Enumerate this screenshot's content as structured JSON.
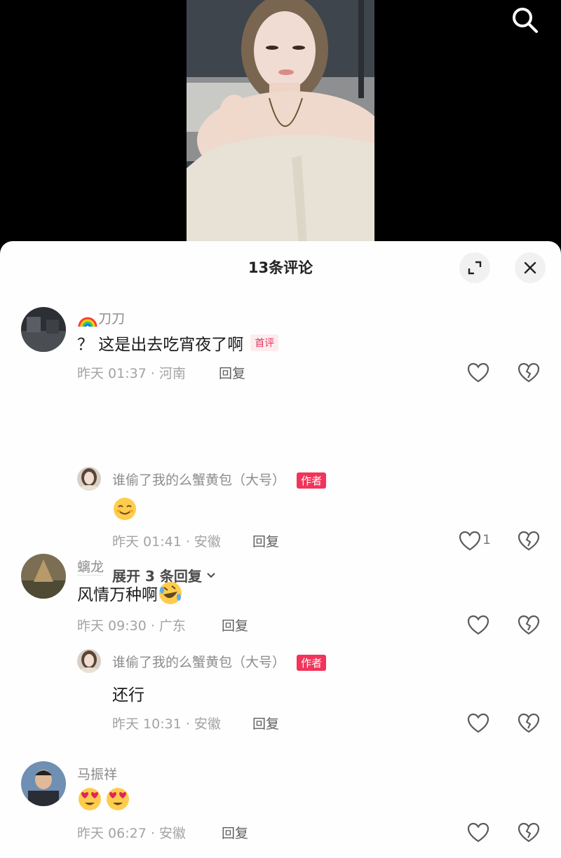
{
  "header": {
    "title": "13条评论"
  },
  "comments": [
    {
      "username": "刀刀",
      "text": "？ 这是出去吃宵夜了啊",
      "badge": "首评",
      "time": "昨天 01:37 · 河南",
      "reply_label": "回复",
      "replies": [
        {
          "username": "谁偷了我的么蟹黄包（大号）",
          "badge": "作者",
          "text": "",
          "time": "昨天 01:41 · 安徽",
          "reply_label": "回复",
          "likes": "1"
        }
      ],
      "expand_label": "展开 3 条回复"
    },
    {
      "username": "螭龙",
      "text": "风情万种啊",
      "time": "昨天 09:30 · 广东",
      "reply_label": "回复",
      "replies": [
        {
          "username": "谁偷了我的么蟹黄包（大号）",
          "badge": "作者",
          "text": "还行",
          "time": "昨天 10:31 · 安徽",
          "reply_label": "回复"
        }
      ]
    },
    {
      "username": "马振祥",
      "text": "",
      "time": "昨天 06:27 · 安徽",
      "reply_label": "回复"
    }
  ],
  "icons": {
    "search": "search-icon",
    "expand": "fullscreen-icon",
    "close": "close-icon",
    "like": "heart-icon",
    "dislike": "broken-heart-icon"
  },
  "colors": {
    "accent": "#f2345a",
    "sheet_bg": "#fefefe"
  }
}
